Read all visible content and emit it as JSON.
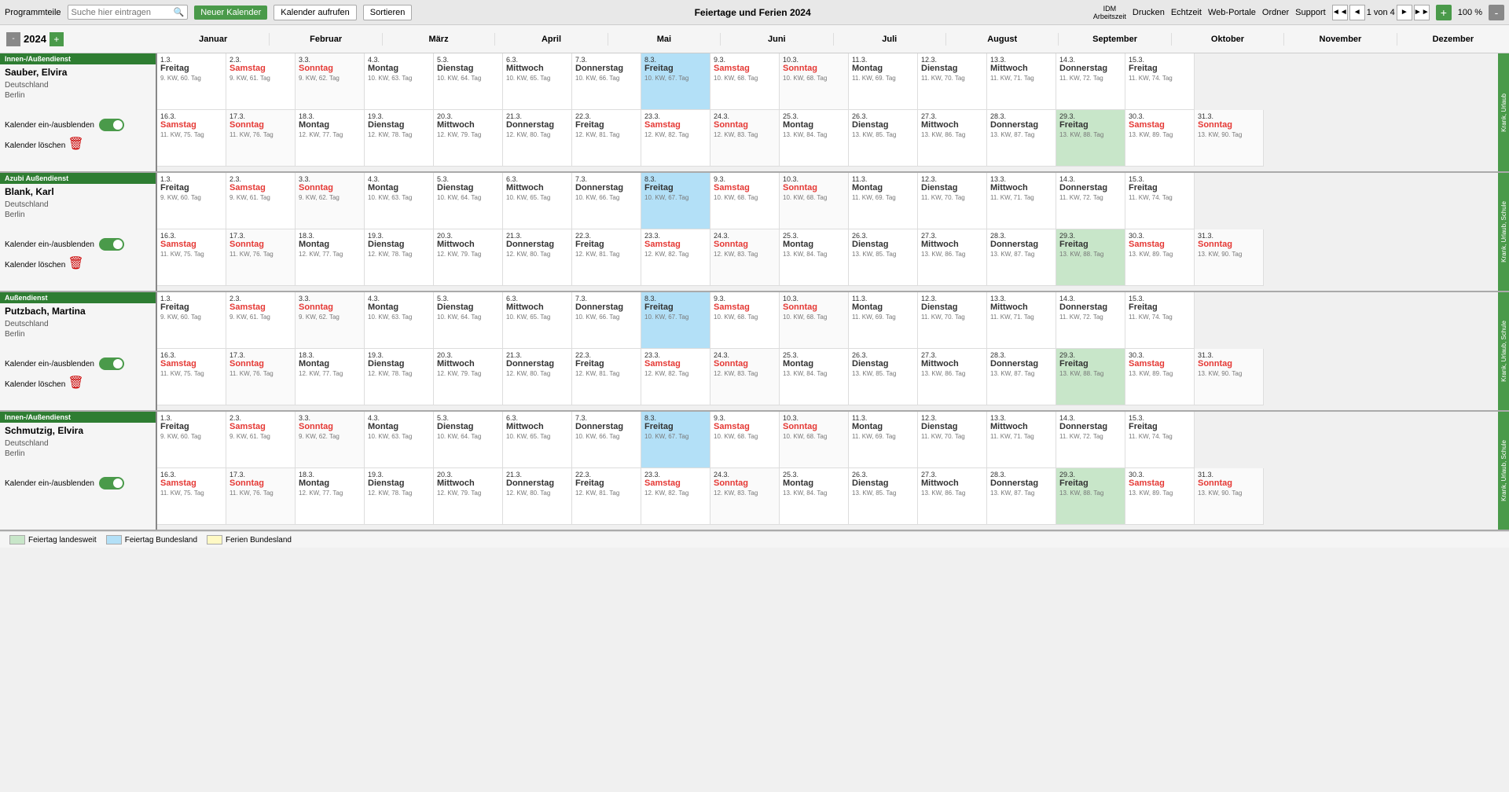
{
  "toolbar": {
    "programmteile": "Programmteile",
    "search_placeholder": "Suche hier eintragen",
    "new_calendar": "Neuer Kalender",
    "open_calendar": "Kalender aufrufen",
    "sort": "Sortieren",
    "title": "Feiertage und Ferien 2024",
    "idm": "IDM",
    "arbeitszeit": "Arbeitszeit",
    "print": "Drucken",
    "realtime": "Echtzeit",
    "web_portale": "Web-Portale",
    "ordner": "Ordner",
    "support": "Support",
    "page_info": "1 von 4",
    "zoom": "100 %"
  },
  "month_header": {
    "year": "2024",
    "months": [
      "Januar",
      "Februar",
      "März",
      "April",
      "Mai",
      "Juni",
      "Juli",
      "August",
      "September",
      "Oktober",
      "November",
      "Dezember"
    ]
  },
  "employees": [
    {
      "id": "emp1",
      "role": "Innen-/Außendienst",
      "name": "Sauber, Elvira",
      "country": "Deutschland",
      "city": "Berlin",
      "side_label": "Krank, Urlaub"
    },
    {
      "id": "emp2",
      "role": "Azubi Außendienst",
      "name": "Blank, Karl",
      "country": "Deutschland",
      "city": "Berlin",
      "side_label": "Krank, Urlaub, Schule"
    },
    {
      "id": "emp3",
      "role": "Außendienst",
      "name": "Putzbach, Martina",
      "country": "Deutschland",
      "city": "Berlin",
      "side_label": "Krank, Urlaub, Schule"
    },
    {
      "id": "emp4",
      "role": "Innen-/Außendienst",
      "name": "Schmutzig, Elvira",
      "country": "Deutschland",
      "city": "Berlin",
      "side_label": "Krank, Urlaub, Schule"
    }
  ],
  "legend": {
    "items": [
      {
        "label": "Feiertag landesweit",
        "color": "#c8e6c9"
      },
      {
        "label": "Feiertag Bundesland",
        "color": "#b3e0f7"
      },
      {
        "label": "Ferien Bundesland",
        "color": "#fff9c4"
      }
    ]
  },
  "cal_toggle_label": "Kalender ein-/ausblenden",
  "cal_delete_label": "Kalender löschen",
  "rows": {
    "row1": [
      {
        "num": "1.3.",
        "name": "Freitag",
        "info": "9. KW, 60. Tag",
        "type": "normal"
      },
      {
        "num": "2.3.",
        "name": "Samstag",
        "info": "9. KW, 61. Tag",
        "type": "sat"
      },
      {
        "num": "3.3.",
        "name": "Sonntag",
        "info": "9. KW, 62. Tag",
        "type": "sun"
      },
      {
        "num": "4.3.",
        "name": "Montag",
        "info": "10. KW, 63. Tag",
        "type": "normal"
      },
      {
        "num": "5.3.",
        "name": "Dienstag",
        "info": "10. KW, 64. Tag",
        "type": "normal"
      },
      {
        "num": "6.3.",
        "name": "Mittwoch",
        "info": "10. KW, 65. Tag",
        "type": "normal"
      },
      {
        "num": "7.3.",
        "name": "Donnerstag",
        "info": "10. KW, 66. Tag",
        "type": "normal"
      },
      {
        "num": "8.3.",
        "name": "Freitag",
        "info": "10. KW, 67. Tag",
        "type": "today"
      },
      {
        "num": "9.3.",
        "name": "Samstag",
        "info": "10. KW, 68. Tag",
        "type": "sat"
      },
      {
        "num": "10.3.",
        "name": "Sonntag",
        "info": "10. KW, 68. Tag",
        "type": "sun"
      },
      {
        "num": "11.3.",
        "name": "Montag",
        "info": "11. KW, 69. Tag",
        "type": "normal"
      },
      {
        "num": "12.3.",
        "name": "Dienstag",
        "info": "11. KW, 70. Tag",
        "type": "normal"
      },
      {
        "num": "13.3.",
        "name": "Mittwoch",
        "info": "11. KW, 71. Tag",
        "type": "normal"
      },
      {
        "num": "14.3.",
        "name": "Donnerstag",
        "info": "11. KW, 72. Tag",
        "type": "normal"
      },
      {
        "num": "15.3.",
        "name": "Freitag",
        "info": "11. KW, 74. Tag",
        "type": "normal"
      }
    ],
    "row2": [
      {
        "num": "16.3.",
        "name": "Samstag",
        "info": "11. KW, 75. Tag",
        "type": "sat"
      },
      {
        "num": "17.3.",
        "name": "Sonntag",
        "info": "11. KW, 76. Tag",
        "type": "sun"
      },
      {
        "num": "18.3.",
        "name": "Montag",
        "info": "12. KW, 77. Tag",
        "type": "normal"
      },
      {
        "num": "19.3.",
        "name": "Dienstag",
        "info": "12. KW, 78. Tag",
        "type": "normal"
      },
      {
        "num": "20.3.",
        "name": "Mittwoch",
        "info": "12. KW, 79. Tag",
        "type": "normal"
      },
      {
        "num": "21.3.",
        "name": "Donnerstag",
        "info": "12. KW, 80. Tag",
        "type": "normal"
      },
      {
        "num": "22.3.",
        "name": "Freitag",
        "info": "12. KW, 81. Tag",
        "type": "normal"
      },
      {
        "num": "23.3.",
        "name": "Samstag",
        "info": "12. KW, 82. Tag",
        "type": "sat"
      },
      {
        "num": "24.3.",
        "name": "Sonntag",
        "info": "12. KW, 83. Tag",
        "type": "sun"
      },
      {
        "num": "25.3.",
        "name": "Montag",
        "info": "13. KW, 84. Tag",
        "type": "normal"
      },
      {
        "num": "26.3.",
        "name": "Dienstag",
        "info": "13. KW, 85. Tag",
        "type": "normal"
      },
      {
        "num": "27.3.",
        "name": "Mittwoch",
        "info": "13. KW, 86. Tag",
        "type": "normal"
      },
      {
        "num": "28.3.",
        "name": "Donnerstag",
        "info": "13. KW, 87. Tag",
        "type": "normal"
      },
      {
        "num": "29.3.",
        "name": "Freitag",
        "info": "13. KW, 88. Tag",
        "type": "holiday_national"
      },
      {
        "num": "30.3.",
        "name": "Samstag",
        "info": "13. KW, 89. Tag",
        "type": "sat"
      },
      {
        "num": "31.3.",
        "name": "Sonntag",
        "info": "13. KW, 90. Tag",
        "type": "sun"
      }
    ]
  }
}
